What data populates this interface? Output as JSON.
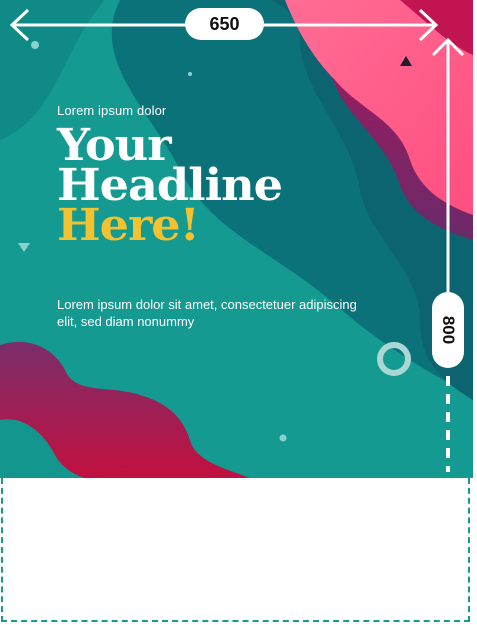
{
  "poster": {
    "eyebrow": "Lorem ipsum dolor",
    "headline_line1": "Your",
    "headline_line2": "Headline",
    "headline_accent": "Here!",
    "body": "Lorem ipsum dolor sit amet, consectetuer adipiscing elit, sed diam nonummy"
  },
  "dimensions": {
    "width_label": "650",
    "height_label": "800"
  },
  "colors": {
    "teal_dark": "#0b6f76",
    "teal_mid": "#14978f",
    "pink": "#ff5f8c",
    "magenta": "#b0104d",
    "accent_yellow": "#f2c230",
    "guide": "#149b93"
  },
  "icons": {
    "dimension_arrow": "double-headed-arrow",
    "triangle": "triangle-shape",
    "ring": "ring-shape"
  }
}
